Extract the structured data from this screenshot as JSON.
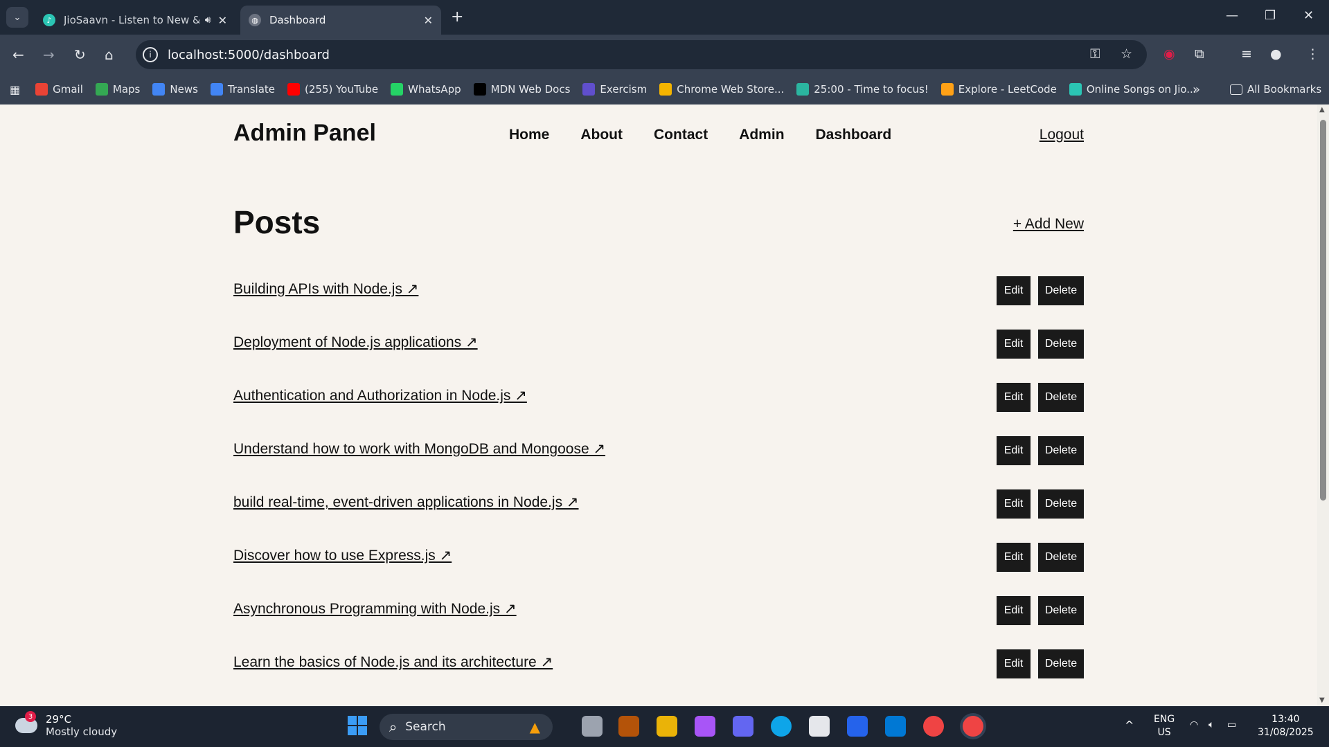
{
  "browser": {
    "tabs": [
      {
        "title": "JioSaavn - Listen to New &",
        "favicon": "jiosaavn-icon",
        "audio": true,
        "active": false
      },
      {
        "title": "Dashboard",
        "favicon": "globe-icon",
        "active": true
      }
    ],
    "url": "localhost:5000/dashboard",
    "bookmarks": [
      {
        "label": "Gmail",
        "icon": "gmail-icon",
        "color": "#ea4335"
      },
      {
        "label": "Maps",
        "icon": "maps-icon",
        "color": "#34a853"
      },
      {
        "label": "News",
        "icon": "news-icon",
        "color": "#4285f4"
      },
      {
        "label": "Translate",
        "icon": "translate-icon",
        "color": "#4285f4"
      },
      {
        "label": "(255) YouTube",
        "icon": "youtube-icon",
        "color": "#ff0000"
      },
      {
        "label": "WhatsApp",
        "icon": "whatsapp-icon",
        "color": "#25d366"
      },
      {
        "label": "MDN Web Docs",
        "icon": "mdn-icon",
        "color": "#000000"
      },
      {
        "label": "Exercism",
        "icon": "exercism-icon",
        "color": "#604fcd"
      },
      {
        "label": "Chrome Web Store...",
        "icon": "webstore-icon",
        "color": "#f4b400"
      },
      {
        "label": "25:00 - Time to focus!",
        "icon": "pomofocus-icon",
        "color": "#2bb5a0"
      },
      {
        "label": "Explore - LeetCode",
        "icon": "leetcode-icon",
        "color": "#ffa116"
      },
      {
        "label": "Online Songs on Jio...",
        "icon": "jiosaavn-icon",
        "color": "#2bc5b4"
      }
    ],
    "all_bookmarks": "All Bookmarks"
  },
  "site": {
    "logo": "Admin Panel",
    "nav": [
      "Home",
      "About",
      "Contact",
      "Admin",
      "Dashboard"
    ],
    "logout": "Logout"
  },
  "posts": {
    "title": "Posts",
    "add_new": "+ Add New",
    "edit_label": "Edit",
    "delete_label": "Delete",
    "items": [
      "Building APIs with Node.js ↗",
      "Deployment of Node.js applications ↗",
      "Authentication and Authorization in Node.js ↗",
      "Understand how to work with MongoDB and Mongoose ↗",
      "build real-time, event-driven applications in Node.js ↗",
      "Discover how to use Express.js ↗",
      "Asynchronous Programming with Node.js ↗",
      "Learn the basics of Node.js and its architecture ↗"
    ]
  },
  "taskbar": {
    "weather_temp": "29°C",
    "weather_desc": "Mostly cloudy",
    "weather_badge": "3",
    "search_label": "Search",
    "lang": "ENG",
    "region": "US",
    "time": "13:40",
    "date": "31/08/2025"
  }
}
